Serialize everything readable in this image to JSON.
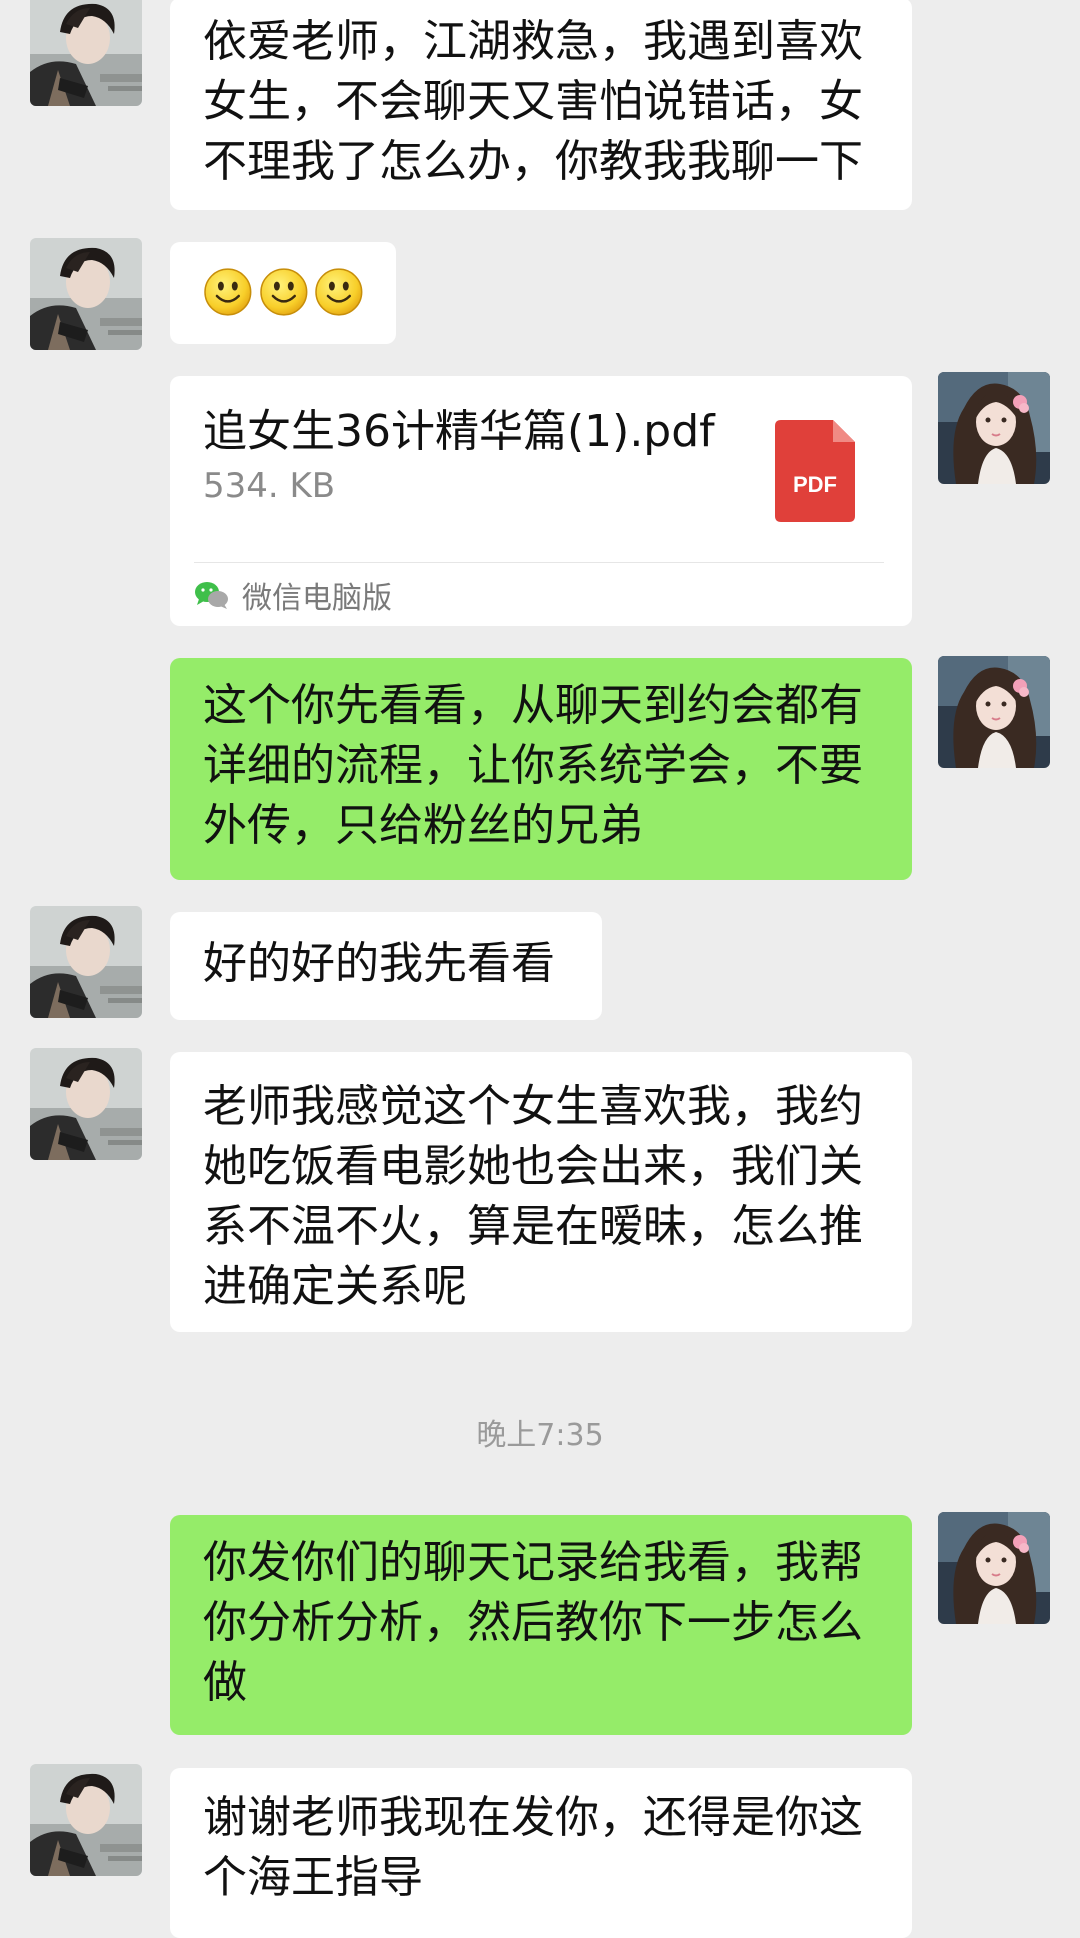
{
  "messages": [
    {
      "sender": "user",
      "lines": [
        "依爱老师，江湖救急，我遇到喜欢",
        "女生，不会聊天又害怕说错话，女",
        "不理我了怎么办，你教我我聊一下"
      ]
    },
    {
      "sender": "user",
      "emoji": [
        "smiley",
        "smiley",
        "smiley"
      ]
    },
    {
      "sender": "teacher",
      "file": {
        "name": "追女生36计精华篇(1).pdf",
        "size": "534. KB",
        "icon_label": "PDF",
        "source": "微信电脑版"
      }
    },
    {
      "sender": "teacher",
      "lines": [
        "这个你先看看，从聊天到约会都有",
        "详细的流程，让你系统学会，不要",
        "外传，只给粉丝的兄弟"
      ]
    },
    {
      "sender": "user",
      "lines": [
        "好的好的我先看看"
      ]
    },
    {
      "sender": "user",
      "lines": [
        "老师我感觉这个女生喜欢我，我约",
        "她吃饭看电影她也会出来，我们关",
        "系不温不火，算是在暧昧，怎么推",
        "进确定关系呢"
      ]
    },
    {
      "timestamp": "晚上7:35"
    },
    {
      "sender": "teacher",
      "lines": [
        "你发你们的聊天记录给我看，我帮",
        "你分析分析，然后教你下一步怎么",
        "做"
      ]
    },
    {
      "sender": "user",
      "lines": [
        "谢谢老师我现在发你，还得是你这",
        "个海王指导"
      ]
    }
  ],
  "colors": {
    "background": "#ededed",
    "incoming_bubble": "#ffffff",
    "outgoing_bubble": "#95ec69",
    "pdf_red": "#e0403a",
    "timestamp": "#9a9a9a"
  },
  "icons": {
    "user_avatar": "user-avatar-photo",
    "teacher_avatar": "teacher-avatar-photo",
    "file_type": "pdf-file-icon",
    "source": "wechat-icon",
    "emoji": "smiley-face-emoji"
  }
}
